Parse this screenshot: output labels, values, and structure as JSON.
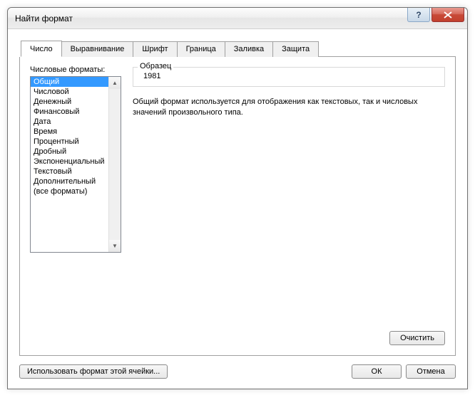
{
  "window": {
    "title": "Найти формат"
  },
  "tabs": [
    "Число",
    "Выравнивание",
    "Шрифт",
    "Граница",
    "Заливка",
    "Защита"
  ],
  "active_tab": 0,
  "format_list": {
    "label": "Числовые форматы:",
    "items": [
      "Общий",
      "Числовой",
      "Денежный",
      "Финансовый",
      "Дата",
      "Время",
      "Процентный",
      "Дробный",
      "Экспоненциальный",
      "Текстовый",
      "Дополнительный",
      "(все форматы)"
    ],
    "selected": 0
  },
  "sample": {
    "legend": "Образец",
    "value": "1981"
  },
  "description": "Общий формат используется для отображения как текстовых, так и числовых значений произвольного типа.",
  "buttons": {
    "clear": "Очистить",
    "use_cell_format": "Использовать формат этой ячейки...",
    "ok": "ОК",
    "cancel": "Отмена"
  }
}
